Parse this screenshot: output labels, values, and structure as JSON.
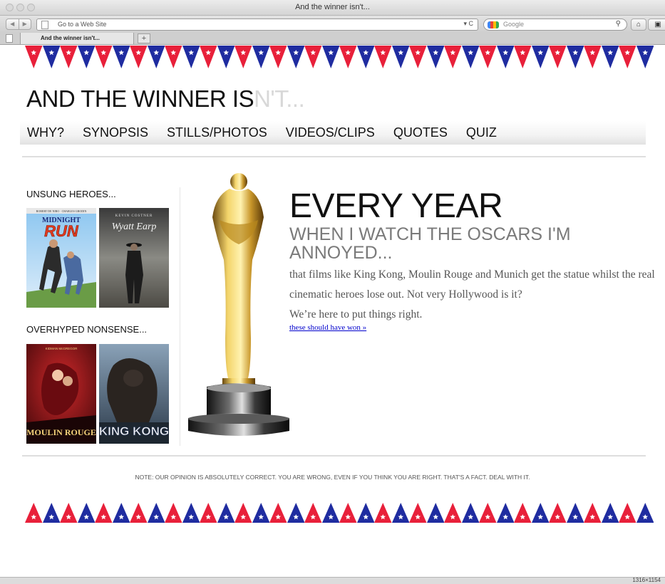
{
  "browser": {
    "window_title": "And the winner isn't...",
    "url_placeholder": "Go to a Web Site",
    "search_placeholder": "Google",
    "tab_title": "And the winner isn't...",
    "new_tab_label": "+",
    "status_right": "1316×1154"
  },
  "site": {
    "title_main": "AND THE WINNER IS",
    "title_faded": "N'T..."
  },
  "nav": {
    "items": [
      "WHY?",
      "SYNOPSIS",
      "STILLS/PHOTOS",
      "VIDEOS/CLIPS",
      "QUOTES",
      "QUIZ"
    ]
  },
  "sidebar": {
    "unsung_heading": "UNSUNG HEROES...",
    "overhyped_heading": "OVERHYPED NONSENSE...",
    "posters": {
      "midnight_run": {
        "top": "ROBERT DE NIRO · CHARLES GRODIN",
        "title1": "MIDNIGHT",
        "title2": "RUN"
      },
      "wyatt_earp": {
        "top": "KEVIN COSTNER",
        "title": "Wyatt Earp"
      },
      "moulin_rouge": {
        "top": "KIDMAN   McGREGOR",
        "title": "MOULIN ROUGE"
      },
      "king_kong": {
        "title": "KING KONG"
      }
    }
  },
  "hero": {
    "heading": "EVERY YEAR",
    "subheading": "WHEN I WATCH THE OSCARS I'M ANNOYED...",
    "body": "that films like King Kong, Moulin Rouge and Munich get the statue whilst the real cinematic heroes lose out. Not very Hollywood is it?",
    "body2": "We’re here to put things right.",
    "link": "these should have won »"
  },
  "footer": {
    "note": "NOTE: OUR OPINION IS ABSOLUTELY CORRECT. YOU ARE WRONG, EVEN IF YOU THINK YOU ARE RIGHT. THAT'S A FACT. DEAL WITH IT."
  },
  "colors": {
    "flag_red": "#e8203a",
    "flag_blue": "#1f2ca0",
    "star": "#ffffff",
    "body_text": "#555555",
    "subheading": "#7a7a7a",
    "link": "#0000cc"
  },
  "icons": {
    "back": "back-arrow-icon",
    "forward": "forward-arrow-icon",
    "reload": "reload-icon",
    "search": "magnifier-icon",
    "home": "home-icon",
    "bookmarks": "bookmarks-icon"
  }
}
